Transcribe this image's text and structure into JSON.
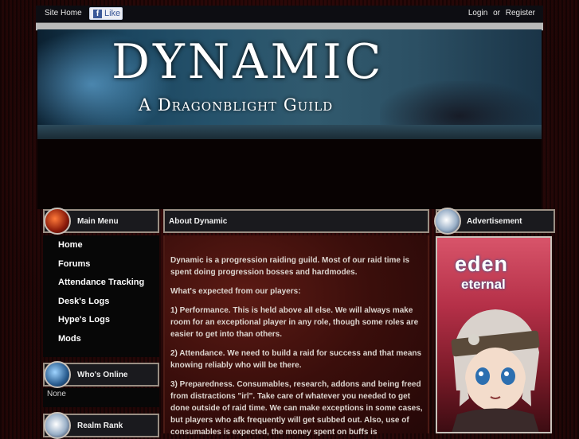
{
  "topbar": {
    "site_home": "Site Home",
    "fb_like": "Like",
    "login": "Login",
    "or": "or",
    "register": "Register"
  },
  "banner": {
    "title": "DYNAMIC",
    "subtitle": "A Dragonblight Guild"
  },
  "sidebar": {
    "main_menu_title": "Main Menu",
    "items": [
      {
        "label": "Home"
      },
      {
        "label": "Forums"
      },
      {
        "label": "Attendance Tracking"
      },
      {
        "label": "Desk's Logs"
      },
      {
        "label": "Hype's Logs"
      },
      {
        "label": "Mods"
      }
    ],
    "whos_online_title": "Who's Online",
    "whos_online_value": "None",
    "realm_rank_title": "Realm Rank"
  },
  "main": {
    "title": "About Dynamic",
    "paragraphs": [
      "Dynamic is a progression raiding guild. Most of our raid time is spent doing progression bosses and hardmodes.",
      "What's expected from our players:",
      "1) Performance. This is held above all else. We will always make room for an exceptional player in any role, though some roles are easier to get into than others.",
      "2) Attendance. We need to build a raid for success and that means knowing reliably who will be there.",
      "3) Preparedness. Consumables, research, addons and being freed from distractions \"irl\". Take care of whatever you needed to get done outside of raid time. We can make exceptions in some cases, but players who afk frequently will get subbed out. Also, use of consumables is expected, the money spent on buffs is"
    ]
  },
  "advertisement": {
    "title": "Advertisement",
    "brand_line1": "eden",
    "brand_line2": "eternal"
  },
  "colors": {
    "background": "#1a0606",
    "panel_border": "#9a8f84",
    "content_bg": "#3a0e0b",
    "text": "#ddd6d0"
  }
}
